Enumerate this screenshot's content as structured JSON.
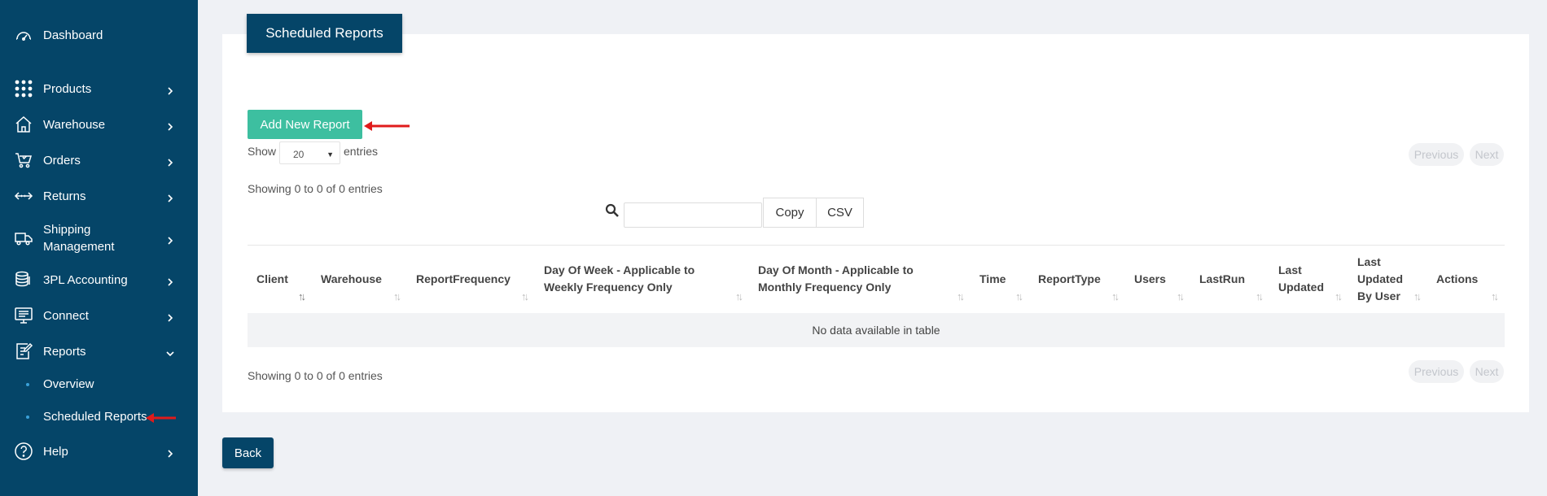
{
  "sidebar": {
    "items": [
      {
        "label": "Dashboard",
        "icon": "speedometer-icon"
      },
      {
        "label": "Products",
        "icon": "grid-dots-icon"
      },
      {
        "label": "Warehouse",
        "icon": "home-icon"
      },
      {
        "label": "Orders",
        "icon": "cart-icon"
      },
      {
        "label": "Returns",
        "icon": "return-arrows-icon"
      },
      {
        "label": "Shipping Management",
        "icon": "truck-icon"
      },
      {
        "label": "3PL Accounting",
        "icon": "coins-icon"
      },
      {
        "label": "Connect",
        "icon": "monitor-icon"
      },
      {
        "label": "Reports",
        "icon": "report-edit-icon"
      },
      {
        "label": "Help",
        "icon": "help-circle-icon"
      }
    ],
    "sub_items": [
      {
        "label": "Overview"
      },
      {
        "label": "Scheduled Reports"
      }
    ]
  },
  "page": {
    "title": "Scheduled Reports",
    "add_button": "Add New Report",
    "show_label": "Show",
    "entries_value": "20",
    "entries_label": "entries",
    "info_top": "Showing 0 to 0 of 0 entries",
    "info_bottom": "Showing 0 to 0 of 0 entries",
    "previous": "Previous",
    "next": "Next",
    "copy": "Copy",
    "csv": "CSV",
    "back": "Back"
  },
  "table": {
    "columns": [
      "Client",
      "Warehouse",
      "ReportFrequency",
      "Day Of Week - Applicable to Weekly Frequency Only",
      "Day Of Month - Applicable to Monthly Frequency Only",
      "Time",
      "ReportType",
      "Users",
      "LastRun",
      "Last Updated",
      "Last Updated By User",
      "Actions"
    ],
    "empty_message": "No data available in table"
  },
  "colors": {
    "sidebar": "#054568",
    "accent_green": "#3dbfa0",
    "annotation_arrow": "#e01b1b"
  }
}
